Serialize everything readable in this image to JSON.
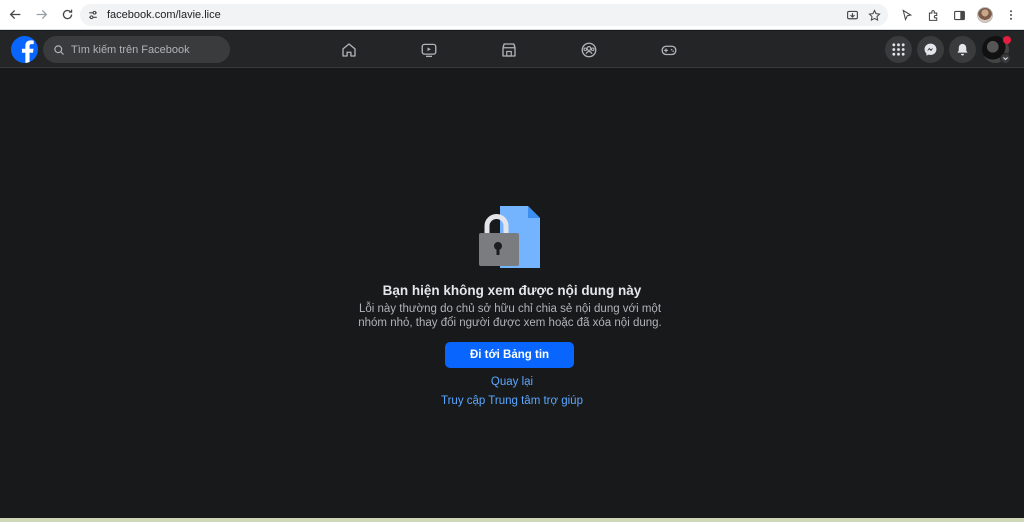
{
  "browser": {
    "url": "facebook.com/lavie.lice"
  },
  "fb": {
    "search_placeholder": "Tìm kiếm trên Facebook",
    "nav": [
      "home-icon",
      "watch-icon",
      "marketplace-icon",
      "groups-icon",
      "gaming-icon"
    ],
    "right": [
      "menu-grid-icon",
      "messenger-icon",
      "notifications-icon"
    ],
    "brand_color": "#0866ff"
  },
  "content": {
    "title": "Bạn hiện không xem được nội dung này",
    "body": "Lỗi này thường do chủ sở hữu chỉ chia sẻ nội dung với một nhóm nhỏ, thay đổi người được xem hoặc đã xóa nội dung.",
    "primary_button": "Đi tới Bảng tin",
    "back_link": "Quay lại",
    "help_link": "Truy cập Trung tâm trợ giúp"
  }
}
